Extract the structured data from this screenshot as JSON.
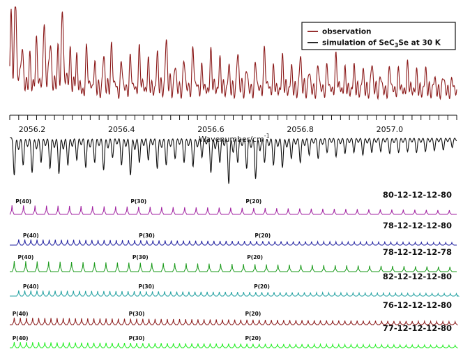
{
  "chart_data": {
    "type": "line",
    "x_axis": {
      "label": "Wavenumber/cm",
      "label_superscript": "-1",
      "range": [
        2056.15,
        2057.15
      ],
      "major_ticks": [
        2056.2,
        2056.4,
        2056.6,
        2056.8,
        2057.0
      ],
      "tick_labels": [
        "2056.2",
        "2056.4",
        "2056.6",
        "2056.8",
        "2057.0"
      ]
    },
    "legend": {
      "placement": "top-right",
      "entries": [
        {
          "text": "observation",
          "color": "#8b1a1a"
        },
        {
          "text_parts": [
            "simulation of SeC",
            "3",
            "Se at 30 K"
          ],
          "color": "#111111"
        }
      ]
    },
    "series": [
      {
        "id": "observation",
        "color": "#8b1a1a",
        "peak_x": [
          2056.153,
          2056.163,
          2056.178,
          2056.195,
          2056.21,
          2056.227,
          2056.241,
          2056.258,
          2056.268,
          2056.285,
          2056.3,
          2056.322,
          2056.34,
          2056.36,
          2056.378,
          2056.4,
          2056.42,
          2056.44,
          2056.46,
          2056.48,
          2056.5,
          2056.52,
          2056.54,
          2056.56,
          2056.58,
          2056.6,
          2056.62,
          2056.64,
          2056.66,
          2056.68,
          2056.7,
          2056.72,
          2056.74,
          2056.76,
          2056.78,
          2056.8,
          2056.82,
          2056.84,
          2056.86,
          2056.88,
          2056.9,
          2056.92,
          2056.94,
          2056.96,
          2056.98,
          2057.0,
          2057.02,
          2057.04,
          2057.06,
          2057.08,
          2057.1,
          2057.12,
          2057.14
        ],
        "peak_intensity": [
          0.88,
          0.96,
          0.55,
          0.42,
          0.6,
          0.82,
          0.58,
          0.5,
          0.85,
          0.48,
          0.4,
          0.52,
          0.35,
          0.45,
          0.55,
          0.38,
          0.42,
          0.5,
          0.36,
          0.45,
          0.62,
          0.34,
          0.4,
          0.52,
          0.3,
          0.46,
          0.38,
          0.32,
          0.48,
          0.3,
          0.36,
          0.5,
          0.28,
          0.4,
          0.3,
          0.44,
          0.28,
          0.34,
          0.32,
          0.42,
          0.26,
          0.3,
          0.28,
          0.36,
          0.22,
          0.3,
          0.26,
          0.32,
          0.24,
          0.28,
          0.2,
          0.22,
          0.18
        ]
      },
      {
        "id": "simulation",
        "color": "#111111",
        "dip_x": [
          2056.16,
          2056.18,
          2056.2,
          2056.22,
          2056.24,
          2056.26,
          2056.28,
          2056.3,
          2056.32,
          2056.34,
          2056.36,
          2056.38,
          2056.4,
          2056.42,
          2056.44,
          2056.46,
          2056.48,
          2056.5,
          2056.52,
          2056.54,
          2056.56,
          2056.58,
          2056.6,
          2056.62,
          2056.64,
          2056.66,
          2056.68,
          2056.7,
          2056.72,
          2056.74,
          2056.76,
          2056.78,
          2056.8,
          2056.82,
          2056.84,
          2056.86,
          2056.88,
          2056.9,
          2056.92,
          2056.94,
          2056.96,
          2056.98,
          2057.0,
          2057.02,
          2057.04,
          2057.06,
          2057.08,
          2057.1,
          2057.12,
          2057.14
        ],
        "dip_depth": [
          0.75,
          0.55,
          0.7,
          0.5,
          0.62,
          0.72,
          0.55,
          0.45,
          0.6,
          0.5,
          0.65,
          0.4,
          0.55,
          0.75,
          0.5,
          0.45,
          0.62,
          0.55,
          0.42,
          0.5,
          0.58,
          0.4,
          0.7,
          0.5,
          0.92,
          0.5,
          0.62,
          0.82,
          0.5,
          0.55,
          0.6,
          0.42,
          0.5,
          0.35,
          0.42,
          0.3,
          0.38,
          0.32,
          0.3,
          0.35,
          0.3,
          0.28,
          0.32,
          0.3,
          0.28,
          0.3,
          0.28,
          0.26,
          0.25,
          0.2
        ]
      }
    ],
    "isotopologues": [
      {
        "name": "80-12-12-12-80",
        "color": "#a020a0",
        "start": 2056.155,
        "spacing": 0.02575,
        "count": 39,
        "labels": [
          {
            "text": "P(40)",
            "index": 1
          },
          {
            "text": "P(30)",
            "index": 11
          },
          {
            "text": "P(20)",
            "index": 21
          }
        ]
      },
      {
        "name": "78-12-12-12-80",
        "color": "#2020a0",
        "start": 2056.17,
        "spacing": 0.01365,
        "count": 73,
        "labels": [
          {
            "text": "P(40)",
            "index": 2
          },
          {
            "text": "P(30)",
            "index": 21
          },
          {
            "text": "P(20)",
            "index": 40
          }
        ]
      },
      {
        "name": "78-12-12-12-78",
        "color": "#1a9a1a",
        "start": 2056.16,
        "spacing": 0.02565,
        "count": 39,
        "labels": [
          {
            "text": "P(40)",
            "index": 1
          },
          {
            "text": "P(30)",
            "index": 11
          },
          {
            "text": "P(20)",
            "index": 21
          }
        ]
      },
      {
        "name": "82-12-12-12-80",
        "color": "#20a0a0",
        "start": 2056.17,
        "spacing": 0.0136,
        "count": 73,
        "labels": [
          {
            "text": "P(40)",
            "index": 2
          },
          {
            "text": "P(30)",
            "index": 21
          },
          {
            "text": "P(20)",
            "index": 40
          }
        ]
      },
      {
        "name": "76-12-12-12-80",
        "color": "#8b1a1a",
        "start": 2056.16,
        "spacing": 0.0137,
        "count": 73,
        "labels": [
          {
            "text": "P(40)",
            "index": 1
          },
          {
            "text": "P(30)",
            "index": 20
          },
          {
            "text": "P(20)",
            "index": 39
          }
        ]
      },
      {
        "name": "77-12-12-12-80",
        "color": "#22ee22",
        "start": 2056.16,
        "spacing": 0.0137,
        "count": 73,
        "labels": [
          {
            "text": "P(40)",
            "index": 1
          },
          {
            "text": "P(30)",
            "index": 20
          },
          {
            "text": "P(20)",
            "index": 39
          }
        ]
      }
    ]
  }
}
